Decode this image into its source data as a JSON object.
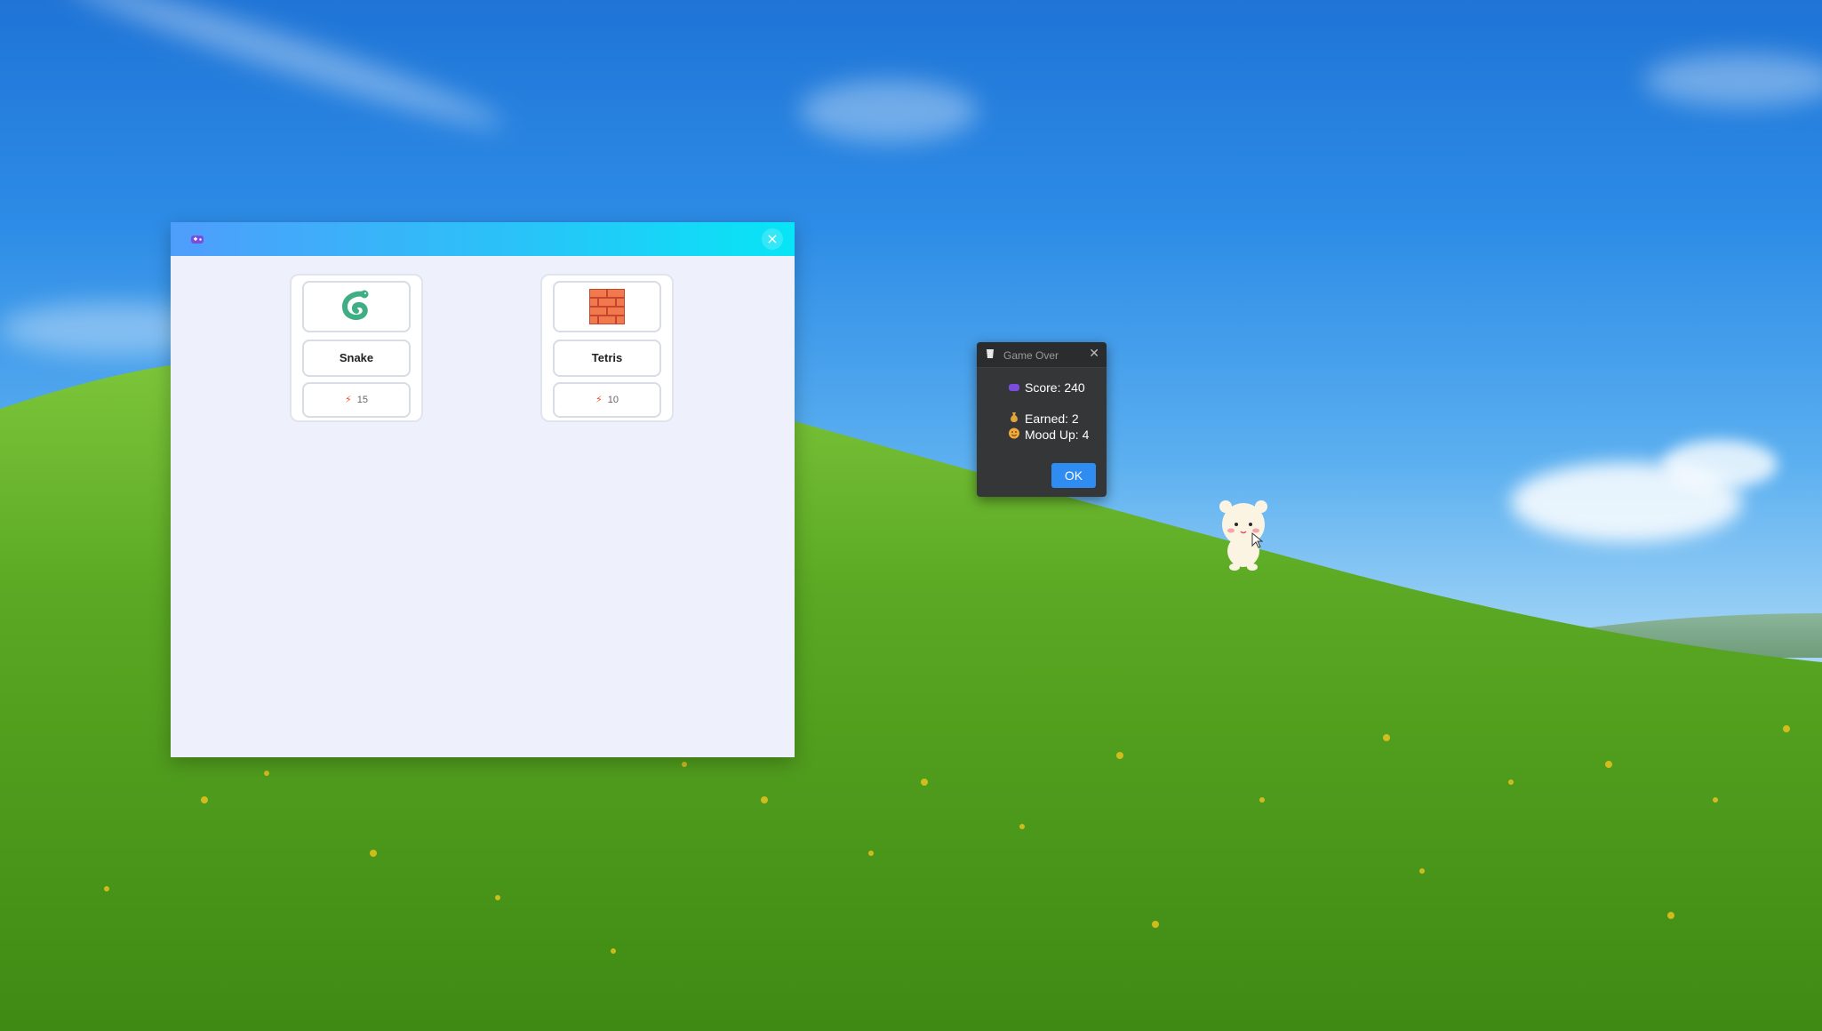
{
  "desktop": {
    "wallpaper": {
      "sky_color": "#2d8ce6",
      "grass_color": "#5aa823"
    }
  },
  "game_window": {
    "title_icon": "gamepad-icon",
    "close_symbol": "×",
    "accent_gradient": [
      "#4f9dfb",
      "#07e5f6"
    ],
    "games": [
      {
        "name": "Snake",
        "icon": "snake-icon",
        "cost": "15"
      },
      {
        "name": "Tetris",
        "icon": "brick-wall-icon",
        "cost": "10"
      }
    ],
    "cost_icon": "lightning-icon"
  },
  "game_over_dialog": {
    "title": "Game Over",
    "title_icon": "cup-icon",
    "close_symbol": "✕",
    "score_icon": "gamepad-icon",
    "score_text": "Score: 240",
    "earned_icon": "money-bag-icon",
    "earned_text": "Earned: 2",
    "mood_icon": "smiley-face-icon",
    "mood_text": "Mood Up: 4",
    "ok_label": "OK",
    "ok_color": "#2f8cf0"
  },
  "pet": {
    "name": "bear-pet"
  }
}
